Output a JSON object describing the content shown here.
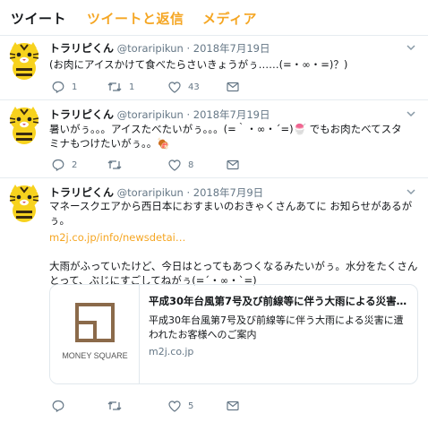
{
  "tabs": [
    "ツイート",
    "ツイートと返信",
    "メディア"
  ],
  "colors": {
    "accent": "#f5a623",
    "text": "#14171a",
    "muted": "#657786"
  },
  "tweets": [
    {
      "name": "トラリピくん",
      "handle": "@toraripikun",
      "date": "2018年7月19日",
      "lines": [
        "(お肉にアイスかけて食べたらさいきょうがぅ……(=・∞・=)？)"
      ],
      "replies": "1",
      "retweets": "1",
      "likes": "43"
    },
    {
      "name": "トラリピくん",
      "handle": "@toraripikun",
      "date": "2018年7月19日",
      "lines": [
        "暑いがぅ。。。アイスたべたいがぅ。。。(=｀・∞・´=)🍧 でもお肉たべてスタ",
        "ミナもつけたいがぅ。。🍖"
      ],
      "replies": "2",
      "retweets": "",
      "likes": "8"
    },
    {
      "name": "トラリピくん",
      "handle": "@toraripikun",
      "date": "2018年7月9日",
      "lines": [
        "マネースクエアから西日本におすまいのおきゃくさんあてに お知らせがあるが",
        "ぅ。"
      ],
      "link": "m2j.co.jp/info/newsdetai…",
      "lines2": [
        "大雨がふっていたけど、今日はとってもあつくなるみたいがぅ。水分をたくさん",
        "とって、ぶじにすごしてねがぅ(=´・∞・`=)"
      ],
      "card": {
        "logo_text": "MONEY SQUARE",
        "title": "平成30年台風第7号及び前線等に伴う大雨による災害…",
        "desc": "平成30年台風第7号及び前線等に伴う大雨による災害に遭われたお客様へのご案内",
        "domain": "m2j.co.jp"
      },
      "replies": "",
      "retweets": "",
      "likes": "5"
    }
  ]
}
